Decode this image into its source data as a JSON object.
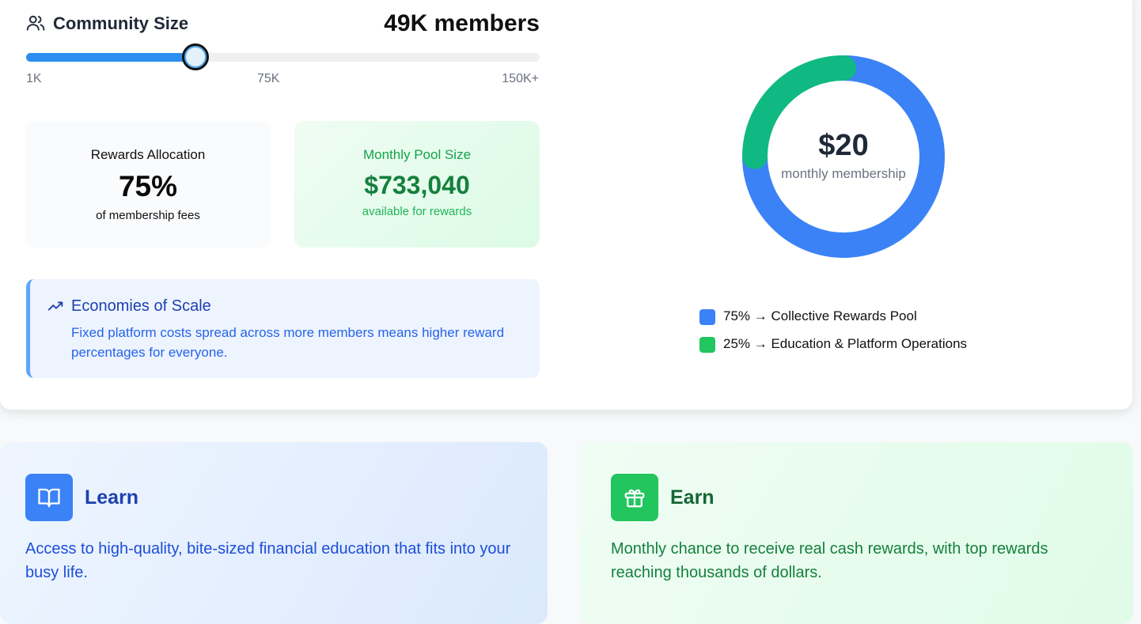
{
  "community": {
    "title": "Community Size",
    "value_label": "49K members",
    "slider": {
      "min_label": "1K",
      "mid_label": "75K",
      "max_label": "150K+",
      "value_fraction": 0.33
    }
  },
  "rewards_allocation": {
    "label": "Rewards Allocation",
    "value": "75%",
    "sub": "of membership fees"
  },
  "monthly_pool": {
    "label": "Monthly Pool Size",
    "value": "$733,040",
    "sub": "available for rewards"
  },
  "economies": {
    "title": "Economies of Scale",
    "text": "Fixed platform costs spread across more members means higher reward percentages for everyone."
  },
  "donut": {
    "amount": "$20",
    "caption": "monthly membership",
    "segments": [
      {
        "fraction": 0.75,
        "color": "#3b82f6"
      },
      {
        "fraction": 0.25,
        "color": "#10b981"
      }
    ]
  },
  "legend": [
    {
      "text": "75% → Collective Rewards Pool",
      "color": "#3b82f6"
    },
    {
      "text": "25% → Education & Platform Operations",
      "color": "#22c55e"
    }
  ],
  "features": {
    "learn": {
      "title": "Learn",
      "icon": "book-open-icon",
      "text": "Access to high-quality, bite-sized financial education that fits into your busy life."
    },
    "earn": {
      "title": "Earn",
      "icon": "gift-icon",
      "text": "Monthly chance to receive real cash rewards, with top rewards reaching thousands of dollars."
    }
  }
}
